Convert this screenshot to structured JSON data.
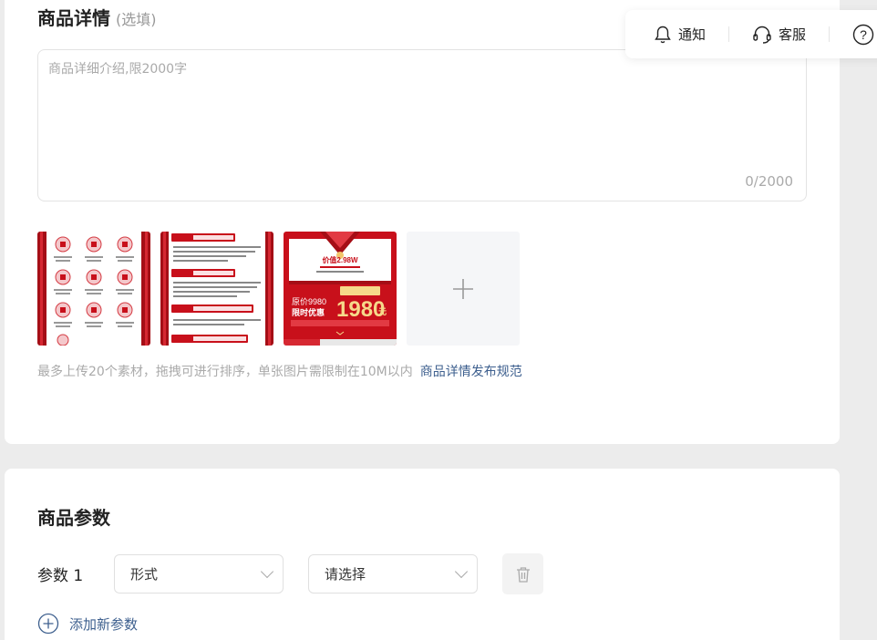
{
  "detail": {
    "title": "商品详情",
    "optional": "(选填)",
    "placeholder": "商品详细介绍,限2000字",
    "counter": "0/2000",
    "thumbnails": [
      {
        "name": "benefits-icon-grid"
      },
      {
        "name": "benefits-list"
      },
      {
        "name": "price-promo-poster",
        "price_value": "价值2.98W",
        "orig_price": "原价9980",
        "promo_label": "限时优惠",
        "promo_price": "1980",
        "unit": "元"
      }
    ],
    "hint": "最多上传20个素材，拖拽可进行排序，单张图片需限制在10M以内",
    "hint_link": "商品详情发布规范"
  },
  "params": {
    "title": "商品参数",
    "row_label": "参数 1",
    "select1_value": "形式",
    "select2_value": "请选择",
    "add_label": "添加新参数"
  },
  "floatbar": {
    "notify_label": "通知",
    "service_label": "客服",
    "help_glyph": "?"
  },
  "colors": {
    "link": "#3d5f8e",
    "poster_red": "#c8101b"
  }
}
